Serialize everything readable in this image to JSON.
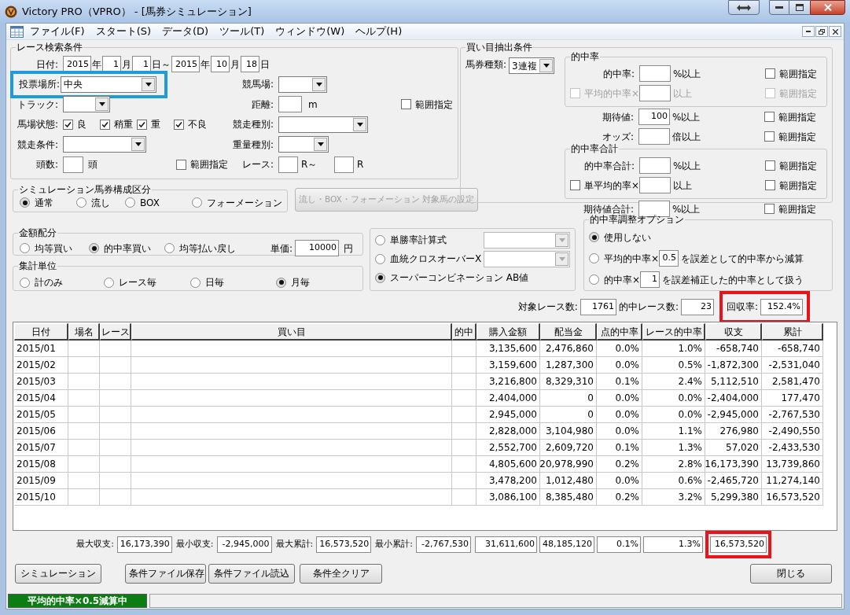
{
  "window": {
    "title": "Victory PRO（VPRO） - [馬券シミュレーション]"
  },
  "menu": [
    {
      "label": "ファイル(F)"
    },
    {
      "label": "スタート(S)"
    },
    {
      "label": "データ(D)"
    },
    {
      "label": "ツール(T)"
    },
    {
      "label": "ウィンドウ(W)"
    },
    {
      "label": "ヘルプ(H)"
    }
  ],
  "search": {
    "title": "レース検索条件",
    "date_label": "日付:",
    "date": [
      {
        "kind": "field",
        "value": "2015"
      },
      {
        "kind": "unit",
        "text": "年"
      },
      {
        "kind": "field",
        "value": "1"
      },
      {
        "kind": "unit",
        "text": "月"
      },
      {
        "kind": "field",
        "value": "1"
      },
      {
        "kind": "unit",
        "text": "日～"
      },
      {
        "kind": "field",
        "value": "2015"
      },
      {
        "kind": "unit",
        "text": "年"
      },
      {
        "kind": "field",
        "value": "10"
      },
      {
        "kind": "unit",
        "text": "月"
      },
      {
        "kind": "field",
        "value": "18"
      },
      {
        "kind": "unit",
        "text": "日"
      }
    ],
    "venue": {
      "label": "投票場所:",
      "value": "中央",
      "highlighted": true
    },
    "course": {
      "label": "競馬場:"
    },
    "track": {
      "label": "トラック:"
    },
    "distance": {
      "label": "距離:",
      "unit": "m"
    },
    "distance_range": {
      "label": "範囲指定",
      "checked": false
    },
    "condition": {
      "label": "馬場状態:",
      "options": [
        {
          "label": "良",
          "checked": true
        },
        {
          "label": "稍重",
          "checked": true
        },
        {
          "label": "重",
          "checked": true
        },
        {
          "label": "不良",
          "checked": true
        }
      ]
    },
    "race_type": {
      "label": "競走種別:"
    },
    "race_condition": {
      "label": "競走条件:"
    },
    "weight_type": {
      "label": "重量種別:"
    },
    "runners": {
      "label": "頭数:",
      "unit": "頭"
    },
    "runners_range": {
      "label": "範囲指定",
      "checked": false
    },
    "race": {
      "label": "レース:",
      "from_unit": "R～",
      "to_unit": "R"
    }
  },
  "extract": {
    "title": "買い目抽出条件",
    "bet_type": {
      "label": "馬券種類:",
      "value": "3連複"
    },
    "items": [
      {
        "kind": "group",
        "title": "的中率",
        "rows": [
          {
            "kind": "label",
            "label": "的中率:",
            "unit": "%以上",
            "disabled": false,
            "range": {
              "label": "範囲指定",
              "checked": false
            }
          },
          {
            "kind": "check",
            "label": "平均的中率×",
            "checked": false,
            "unit": "以上",
            "disabled": true,
            "range": {
              "label": "範囲指定",
              "checked": false
            }
          }
        ]
      },
      {
        "kind": "row",
        "row": {
          "kind": "label",
          "label": "期待値:",
          "value": "100",
          "unit": "%以上",
          "disabled": false,
          "range": {
            "label": "範囲指定",
            "checked": false
          }
        }
      },
      {
        "kind": "row",
        "row": {
          "kind": "label",
          "label": "オッズ:",
          "unit": "倍以上",
          "disabled": false,
          "range": {
            "label": "範囲指定",
            "checked": false
          }
        }
      },
      {
        "kind": "group",
        "title": "的中率合計",
        "rows": [
          {
            "kind": "label",
            "label": "的中率合計:",
            "unit": "%以上",
            "disabled": false,
            "range": {
              "label": "範囲指定",
              "checked": false
            }
          },
          {
            "kind": "check",
            "label": "単平均的率×",
            "checked": false,
            "unit": "以上",
            "disabled": false,
            "range": {
              "label": "範囲指定",
              "checked": false
            }
          }
        ]
      },
      {
        "kind": "row",
        "row": {
          "kind": "label",
          "label": "期待値合計:",
          "unit": "%以上",
          "disabled": false,
          "range": {
            "label": "範囲指定",
            "checked": false
          }
        }
      }
    ]
  },
  "simulation": {
    "title": "シミュレーション馬券構成区分",
    "options": [
      {
        "label": "通常",
        "selected": true
      },
      {
        "label": "流し",
        "selected": false
      },
      {
        "label": "BOX",
        "selected": false
      },
      {
        "label": "フォーメーション",
        "selected": false
      }
    ],
    "button": {
      "label": "流し・BOX・フォーメーション  対象馬の設定",
      "disabled": true
    }
  },
  "amount": {
    "title": "金額配分",
    "options": [
      {
        "label": "均等買い",
        "selected": false
      },
      {
        "label": "的中率買い",
        "selected": true
      },
      {
        "label": "均等払い戻し",
        "selected": false
      }
    ],
    "unit_price": {
      "label": "単価:",
      "value": "10000",
      "unit": "円"
    }
  },
  "aggregate": {
    "title": "集計単位",
    "options": [
      {
        "label": "計のみ",
        "selected": false
      },
      {
        "label": "レース毎",
        "selected": false
      },
      {
        "label": "日毎",
        "selected": false
      },
      {
        "label": "月毎",
        "selected": true
      }
    ]
  },
  "method": {
    "options": [
      {
        "kind": "with_select",
        "label": "単勝率計算式",
        "selected": false
      },
      {
        "kind": "with_select",
        "label": "血統クロスオーバーX",
        "selected": false
      },
      {
        "kind": "plain",
        "label": "スーパーコンビネーション AB値",
        "selected": true
      }
    ]
  },
  "adjust": {
    "title": "的中率調整オプション",
    "options": [
      {
        "kind": "plain",
        "label": "使用しない",
        "selected": true
      },
      {
        "kind": "factor",
        "label": "平均的中率×",
        "value": "0.5",
        "suffix": "を誤差として的中率から減算",
        "selected": false
      },
      {
        "kind": "factor",
        "label": "的中率×",
        "value": "1",
        "suffix": "を誤差補正した的中率として扱う",
        "selected": false
      }
    ]
  },
  "stats": [
    {
      "label": "対象レース数:",
      "value": "1761",
      "highlighted": false
    },
    {
      "label": "的中レース数:",
      "value": "23",
      "highlighted": false
    },
    {
      "label": "回収率:",
      "value": "152.4%",
      "highlighted": true
    }
  ],
  "table": {
    "columns": [
      "日付",
      "場名",
      "レース",
      "買い目",
      "的中",
      "購入金額",
      "配当金",
      "点的中率",
      "レース的中率",
      "収支",
      "累計"
    ],
    "rows": [
      {
        "date": "2015/01",
        "purchase": "3,135,600",
        "payout": "2,476,860",
        "point_rate": "0.0%",
        "race_rate": "1.0%",
        "balance": "-658,740",
        "cumulative": "-658,740"
      },
      {
        "date": "2015/02",
        "purchase": "3,159,600",
        "payout": "1,287,300",
        "point_rate": "0.0%",
        "race_rate": "0.5%",
        "balance": "-1,872,300",
        "cumulative": "-2,531,040"
      },
      {
        "date": "2015/03",
        "purchase": "3,216,800",
        "payout": "8,329,310",
        "point_rate": "0.1%",
        "race_rate": "2.4%",
        "balance": "5,112,510",
        "cumulative": "2,581,470"
      },
      {
        "date": "2015/04",
        "purchase": "2,404,000",
        "payout": "0",
        "point_rate": "0.0%",
        "race_rate": "0.0%",
        "balance": "-2,404,000",
        "cumulative": "177,470"
      },
      {
        "date": "2015/05",
        "purchase": "2,945,000",
        "payout": "0",
        "point_rate": "0.0%",
        "race_rate": "0.0%",
        "balance": "-2,945,000",
        "cumulative": "-2,767,530"
      },
      {
        "date": "2015/06",
        "purchase": "2,828,000",
        "payout": "3,104,980",
        "point_rate": "0.0%",
        "race_rate": "1.1%",
        "balance": "276,980",
        "cumulative": "-2,490,550"
      },
      {
        "date": "2015/07",
        "purchase": "2,552,700",
        "payout": "2,609,720",
        "point_rate": "0.1%",
        "race_rate": "1.3%",
        "balance": "57,020",
        "cumulative": "-2,433,530"
      },
      {
        "date": "2015/08",
        "purchase": "4,805,600",
        "payout": "20,978,990",
        "point_rate": "0.2%",
        "race_rate": "2.8%",
        "balance": "16,173,390",
        "cumulative": "13,739,860"
      },
      {
        "date": "2015/09",
        "purchase": "3,478,200",
        "payout": "1,012,480",
        "point_rate": "0.0%",
        "race_rate": "0.6%",
        "balance": "-2,465,720",
        "cumulative": "11,274,140"
      },
      {
        "date": "2015/10",
        "purchase": "3,086,100",
        "payout": "8,385,480",
        "point_rate": "0.2%",
        "race_rate": "3.2%",
        "balance": "5,299,380",
        "cumulative": "16,573,520"
      }
    ]
  },
  "summary": [
    {
      "label": "最大収支:",
      "value": "16,173,390"
    },
    {
      "label": "最小収支:",
      "value": "-2,945,000"
    },
    {
      "label": "最大累計:",
      "value": "16,573,520"
    },
    {
      "label": "最小累計:",
      "value": "-2,767,530"
    }
  ],
  "totals": [
    {
      "value": "31,611,600",
      "highlighted": false
    },
    {
      "value": "48,185,120",
      "highlighted": false
    },
    {
      "value": "0.1%",
      "highlighted": false
    },
    {
      "value": "1.3%",
      "highlighted": false
    },
    {
      "value": "16,573,520",
      "highlighted": true
    }
  ],
  "buttons": [
    {
      "kind": "action",
      "label": "シミュレーション"
    },
    {
      "kind": "action",
      "label": "条件ファイル保存"
    },
    {
      "kind": "action",
      "label": "条件ファイル読込"
    },
    {
      "kind": "action",
      "label": "条件全クリア"
    },
    {
      "kind": "close",
      "label": "閉じる"
    }
  ],
  "status_bar": {
    "text": "平均的中率×0.5減算中"
  }
}
